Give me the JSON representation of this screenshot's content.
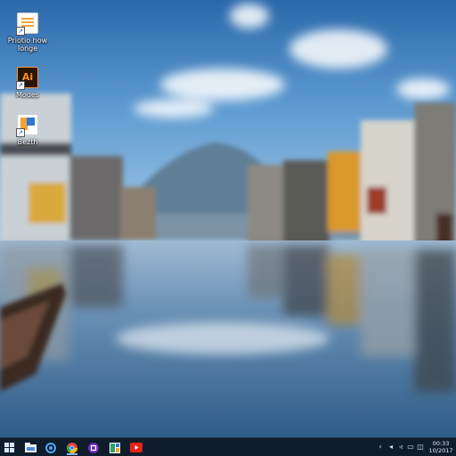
{
  "desktop": {
    "icons": [
      {
        "label_line1": "Priotio how",
        "label_line2": "Ionge",
        "icon": "document-icon"
      },
      {
        "label_line1": "Modes",
        "label_line2": "",
        "icon": "illustrator-icon",
        "glyph": "Ai"
      },
      {
        "label_line1": "Bezth",
        "label_line2": "",
        "icon": "app-tile-icon"
      }
    ]
  },
  "taskbar": {
    "buttons": [
      {
        "icon": "windows-start-icon"
      },
      {
        "icon": "file-explorer-icon"
      },
      {
        "icon": "search-icon"
      },
      {
        "icon": "chrome-icon"
      },
      {
        "icon": "purple-app-icon"
      },
      {
        "icon": "tiles-app-icon"
      },
      {
        "icon": "youtube-icon"
      }
    ],
    "tray": {
      "icons": [
        "chevron-up-icon",
        "network-icon",
        "volume-icon",
        "notification-icon",
        "action-center-icon"
      ],
      "time": "00:33",
      "date": "10/2017"
    }
  },
  "colors": {
    "taskbar": "#0f1c2b",
    "chrome_red": "#e94435",
    "chrome_green": "#35a853",
    "chrome_yellow": "#fbbc05",
    "youtube_red": "#e62117",
    "purple_app": "#6b2fb3"
  }
}
